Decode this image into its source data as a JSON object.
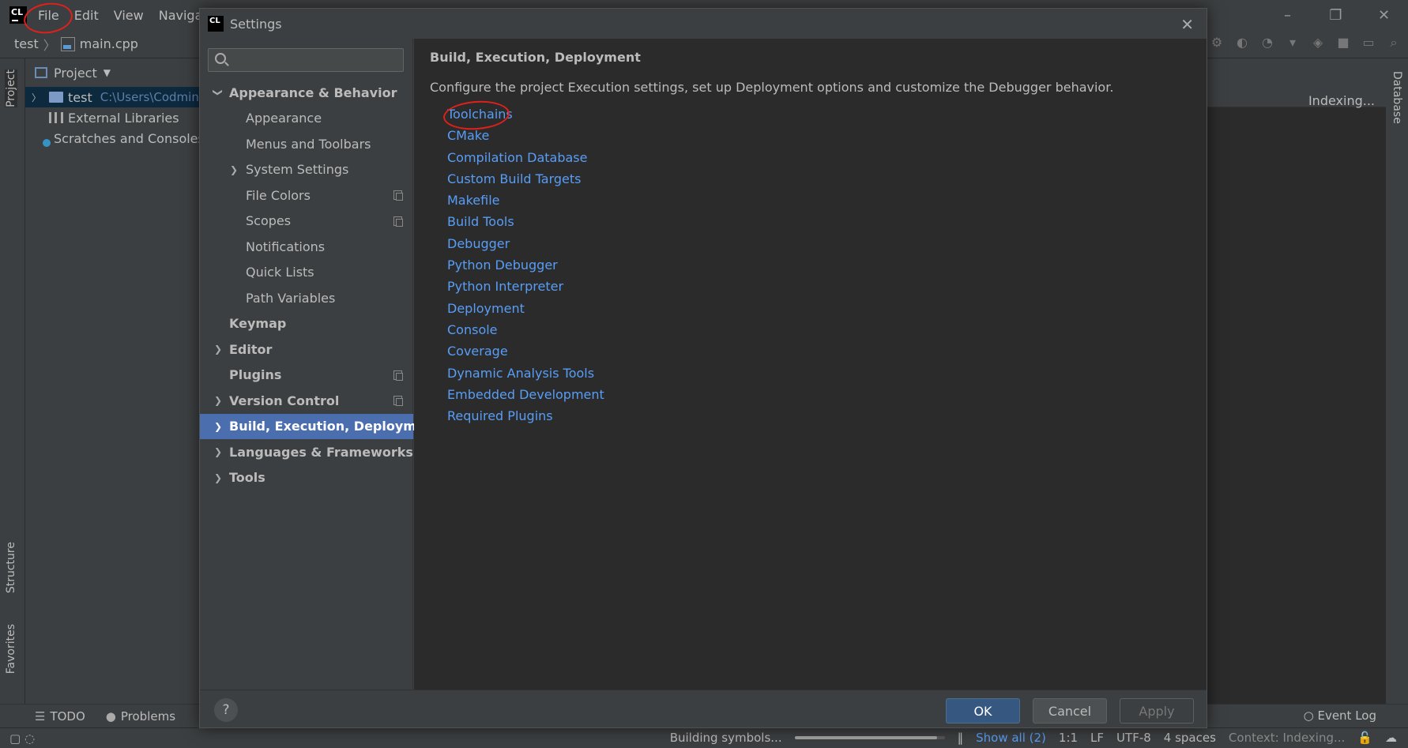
{
  "ide": {
    "logo": "CL",
    "menu": [
      "File",
      "Edit",
      "View",
      "Navigate"
    ],
    "window_controls": [
      "–",
      "❐",
      "✕"
    ],
    "breadcrumb": {
      "project": "test",
      "file": "main.cpp"
    }
  },
  "left_strip": {
    "project_tab": "Project",
    "structure_tab": "Structure",
    "favorites_tab": "Favorites"
  },
  "project_panel": {
    "title": "Project",
    "tree": [
      {
        "label": "test",
        "path": "C:\\Users\\Codmin"
      },
      {
        "label": "External Libraries"
      },
      {
        "label": "Scratches and Consoles"
      }
    ]
  },
  "editor": {
    "status": "Indexing..."
  },
  "right_strip": {
    "database_tab": "Database"
  },
  "settings": {
    "title": "Settings",
    "search_placeholder": "",
    "nav": [
      {
        "label": "Appearance & Behavior",
        "level": 0,
        "expandable": true,
        "expanded": true
      },
      {
        "label": "Appearance",
        "level": 1
      },
      {
        "label": "Menus and Toolbars",
        "level": 1
      },
      {
        "label": "System Settings",
        "level": 1,
        "expandable": true
      },
      {
        "label": "File Colors",
        "level": 1,
        "copy": true
      },
      {
        "label": "Scopes",
        "level": 1,
        "copy": true
      },
      {
        "label": "Notifications",
        "level": 1
      },
      {
        "label": "Quick Lists",
        "level": 1
      },
      {
        "label": "Path Variables",
        "level": 1
      },
      {
        "label": "Keymap",
        "level": 0
      },
      {
        "label": "Editor",
        "level": 0,
        "expandable": true
      },
      {
        "label": "Plugins",
        "level": 0,
        "copy": true
      },
      {
        "label": "Version Control",
        "level": 0,
        "expandable": true,
        "copy": true
      },
      {
        "label": "Build, Execution, Deployment",
        "level": 0,
        "expandable": true,
        "selected": true
      },
      {
        "label": "Languages & Frameworks",
        "level": 0,
        "expandable": true
      },
      {
        "label": "Tools",
        "level": 0,
        "expandable": true
      }
    ],
    "section_title": "Build, Execution, Deployment",
    "section_description": "Configure the project Execution settings, set up Deployment options and customize the Debugger behavior.",
    "links": [
      "Toolchains",
      "CMake",
      "Compilation Database",
      "Custom Build Targets",
      "Makefile",
      "Build Tools",
      "Debugger",
      "Python Debugger",
      "Python Interpreter",
      "Deployment",
      "Console",
      "Coverage",
      "Dynamic Analysis Tools",
      "Embedded Development",
      "Required Plugins"
    ],
    "buttons": {
      "help": "?",
      "ok": "OK",
      "cancel": "Cancel",
      "apply": "Apply"
    }
  },
  "bottom_bar": {
    "todo": "TODO",
    "problems": "Problems",
    "event_log": "Event Log"
  },
  "status_bar": {
    "task": "Building symbols...",
    "progress": 0.95,
    "show_all": "Show all (2)",
    "position": "1:1",
    "line_sep": "LF",
    "encoding": "UTF-8",
    "indent": "4 spaces",
    "context": "Context: Indexing..."
  },
  "colors": {
    "accent": "#4b6eaf",
    "link": "#589df6",
    "annotation": "#e0201b",
    "ok_button": "#365880"
  }
}
